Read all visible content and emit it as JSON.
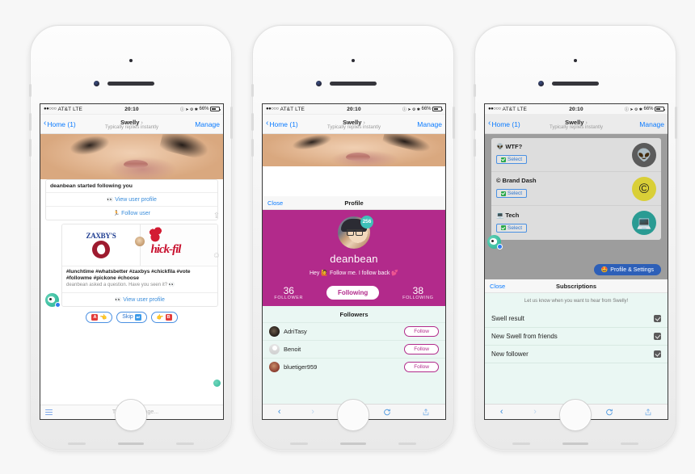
{
  "status_bar": {
    "signal_dots": "●●○○○",
    "carrier": "AT&T",
    "network": "LTE",
    "time": "20:10",
    "icons": "ⓘ ➤ ⚙ ✱",
    "battery_percent": "66%"
  },
  "nav": {
    "back_label": "Home (1)",
    "title": "Swelly",
    "title_arrow": "›",
    "subtitle": "Typically replies instantly",
    "right_label": "Manage"
  },
  "phone1": {
    "follow_card": {
      "title": "deanbean started following you",
      "action_view_label": "View user profile",
      "action_view_emoji": "👀",
      "action_follow_label": "Follow user",
      "action_follow_emoji": "🏃"
    },
    "poll_card": {
      "brand_a": "ZAXBY'S",
      "brand_b": "hick-fil",
      "tags": "#lunchtime #whatsbetter #zaxbys #chickfila #vote #followme #pickone #choose",
      "subtitle": "deanbean asked a question. Have you seen it? 👀",
      "action_view_label": "View user profile",
      "action_view_emoji": "👀"
    },
    "votes": [
      {
        "name": "vote-a",
        "badge": "A",
        "badge_color": "#e23b3b",
        "emoji": "👈",
        "label": ""
      },
      {
        "name": "vote-skip",
        "badge": "⏭",
        "badge_color": "#3d9be9",
        "emoji": "",
        "label": "Skip"
      },
      {
        "name": "vote-b",
        "badge": "B",
        "badge_color": "#e23b3b",
        "emoji": "👉",
        "label": ""
      }
    ],
    "input_placeholder": "Type a message..."
  },
  "phone2": {
    "modal": {
      "close_label": "Close",
      "title": "Profile"
    },
    "profile": {
      "avatar_badge": "256",
      "name": "deanbean",
      "bio": "Hey 🙋 Follow me. I follow back 💕",
      "follower_count": "36",
      "follower_label": "FOLLOWER",
      "following_count": "38",
      "following_label": "FOLLOWING",
      "follow_button": "Following"
    },
    "followers_header": "Followers",
    "followers": [
      {
        "name": "AdriTasy",
        "button": "Follow"
      },
      {
        "name": "Benoit",
        "button": "Follow"
      },
      {
        "name": "bluetiger959",
        "button": "Follow"
      }
    ]
  },
  "phone3": {
    "categories": [
      {
        "emoji": "👽",
        "name": "WTF?",
        "select_label": "Select",
        "icon": "👽"
      },
      {
        "emoji": "©",
        "name": "Brand Dash",
        "select_label": "Select",
        "icon": "©"
      },
      {
        "emoji": "💻",
        "name": "Tech",
        "select_label": "Select",
        "icon": "💻"
      }
    ],
    "profile_settings_button": "Profile & Settings",
    "profile_settings_emoji": "🤩",
    "subs": {
      "close_label": "Close",
      "title": "Subscriptions",
      "note": "Let us know when you want to hear from Swelly!",
      "rows": [
        {
          "label": "Swell result",
          "checked": true
        },
        {
          "label": "New Swell from friends",
          "checked": true
        },
        {
          "label": "New follower",
          "checked": true
        }
      ]
    }
  },
  "safari_toolbar": {
    "back": "‹",
    "forward": "›",
    "bookmarks": "bookmarks-heart-icon",
    "reload": "reload-icon",
    "share": "share-icon"
  },
  "colors": {
    "magenta": "#b22a8b",
    "ios_blue": "#0b7bff",
    "teal": "#3fc0a3",
    "mint_bg": "#eaf7f3"
  }
}
